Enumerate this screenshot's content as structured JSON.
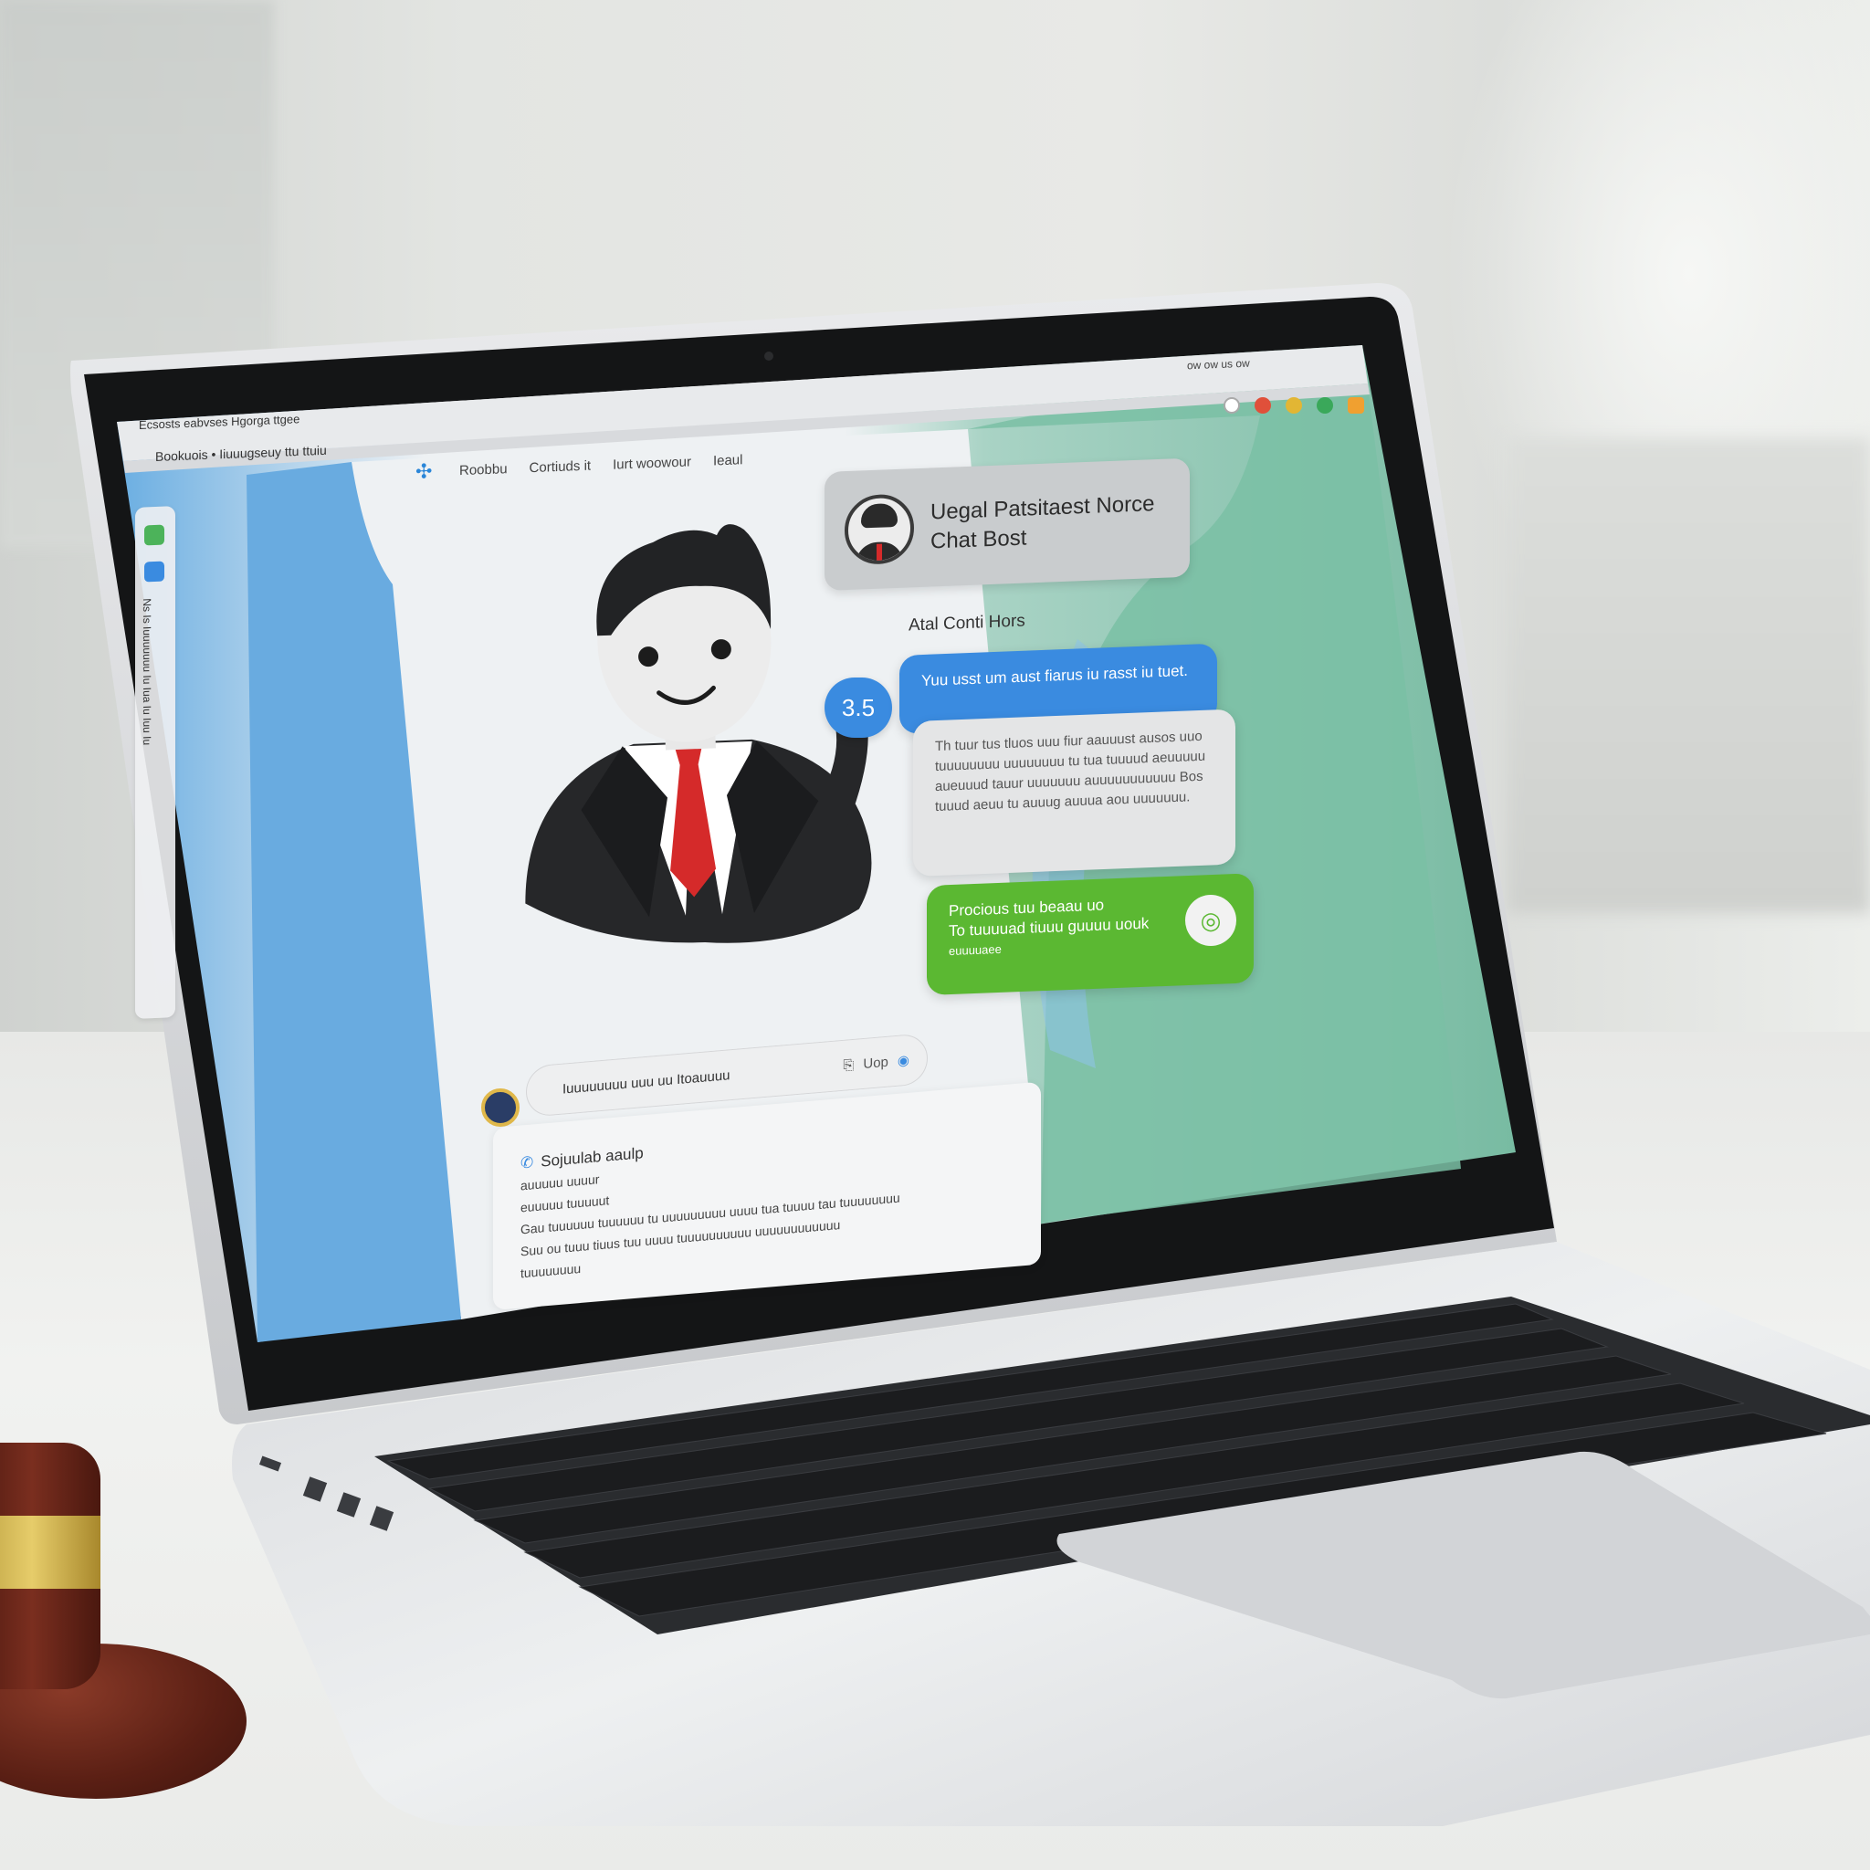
{
  "browser": {
    "tab_text": "Ecsosts eabvses Hgorga ttgee",
    "bookmarks": "Bookuois • Iiuuugseuy ttu ttuiu",
    "right_label": "ow ow us ow"
  },
  "app": {
    "nav_items": [
      "Roobbu",
      "Cortiuds it",
      "Iurt woowour",
      "Ieaul"
    ],
    "bot_title_line1": "Uegal Patsitaest Norce",
    "bot_title_line2": "Chat Bost",
    "chat_subtitle": "Atal Conti Hors",
    "rating": "3.5",
    "blue_message": "Yuu usst um aust fiarus iu rasst iu tuet.",
    "grey_message": "Th tuur tus tluos uuu fiur aauuust ausos uuo tuuuuuuuu uuuuuuuu tu tua tuuuud aeuuuuu aueuuud tauur uuuuuuu auuuuuuuuuuu Bos tuuud aeuu tu auuug auuua aou uuuuuuu.",
    "green_message_line1": "Procious tuu beaau uo",
    "green_message_line2": "To tuuuuad tiuuu guuuu uouk",
    "green_message_line3": "euuuuaee",
    "input_placeholder": "Iuuuuuuuu uuu uu Itoauuuu",
    "input_action": "Uop",
    "info_heading": "Sojuulab aaulp",
    "info_lines": [
      "auuuuu uuuur",
      "euuuuu tuuuuut",
      "Gau tuuuuuu tuuuuuu tu uuuuuuuuu uuuu tua tuuuu tau tuuuuuuuu",
      "Suu ou tuuu tiuus tuu uuuu tuuuuuuuuuu uuuuuuuuuuuu",
      "tuuuuuuuu"
    ],
    "rail_text": "Ns Is Iuuuuuuu Iu Iua Iu Iuu Iu"
  },
  "colors": {
    "accent_blue": "#3a8be0",
    "accent_green": "#5bb832",
    "tie_red": "#d52a2a",
    "bg_left_blue": "#69abe0",
    "bg_right_green": "#7ac0a4"
  },
  "icons": {
    "logo": "app-logo-icon",
    "send": "send-icon",
    "chat_green": "chat-bubble-icon",
    "phone": "phone-icon"
  }
}
